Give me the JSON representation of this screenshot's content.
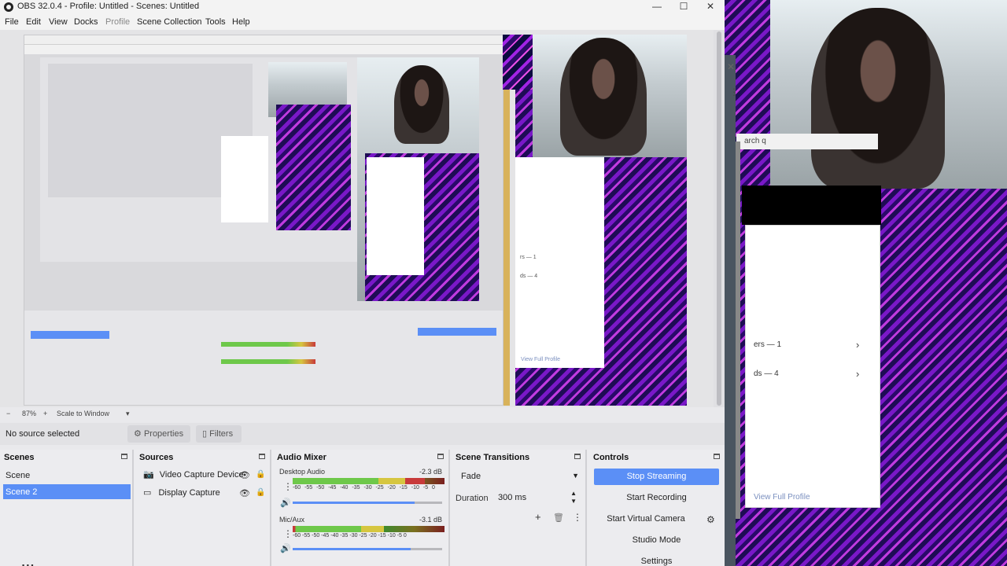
{
  "window": {
    "title": "OBS 32.0.4 - Profile: Untitled - Scenes: Untitled"
  },
  "menu": [
    "File",
    "Edit",
    "View",
    "Docks",
    "Profile",
    "Scene Collection",
    "Tools",
    "Help"
  ],
  "zoom": {
    "value": "87%",
    "mode": "Scale to Window"
  },
  "source_bar": {
    "no_source": "No source selected",
    "properties": "Properties",
    "filters": "Filters"
  },
  "scenes": {
    "title": "Scenes",
    "items": [
      "Scene",
      "Scene 2"
    ],
    "selected": "Scene 2"
  },
  "sources": {
    "title": "Sources",
    "items": [
      "Video Capture Device",
      "Display Capture"
    ]
  },
  "audio_mixer": {
    "title": "Audio Mixer",
    "channels": [
      {
        "name": "Desktop Audio",
        "db": "-2.3 dB",
        "level": 0.87
      },
      {
        "name": "Mic/Aux",
        "db": "-3.1 dB",
        "level": 0.6
      }
    ],
    "scale": [
      "-60",
      "-55",
      "-50",
      "-45",
      "-40",
      "-35",
      "-30",
      "-25",
      "-20",
      "-15",
      "-10",
      "-5",
      "0"
    ]
  },
  "scene_transitions": {
    "title": "Scene Transitions",
    "transition": "Fade",
    "duration_label": "Duration",
    "duration": "300 ms"
  },
  "controls": {
    "title": "Controls",
    "buttons": [
      "Stop Streaming",
      "Start Recording",
      "Start Virtual Camera",
      "Studio Mode",
      "Settings"
    ]
  },
  "right_panel": {
    "search": "arch q",
    "rows": [
      "ers — 1",
      "ds — 4"
    ],
    "link": "View Full Profile"
  },
  "colors": {
    "accent": "#5b8ff6",
    "meter_green": "#6ec84a",
    "meter_yellow": "#d6c640",
    "meter_red": "#c83a3a"
  }
}
